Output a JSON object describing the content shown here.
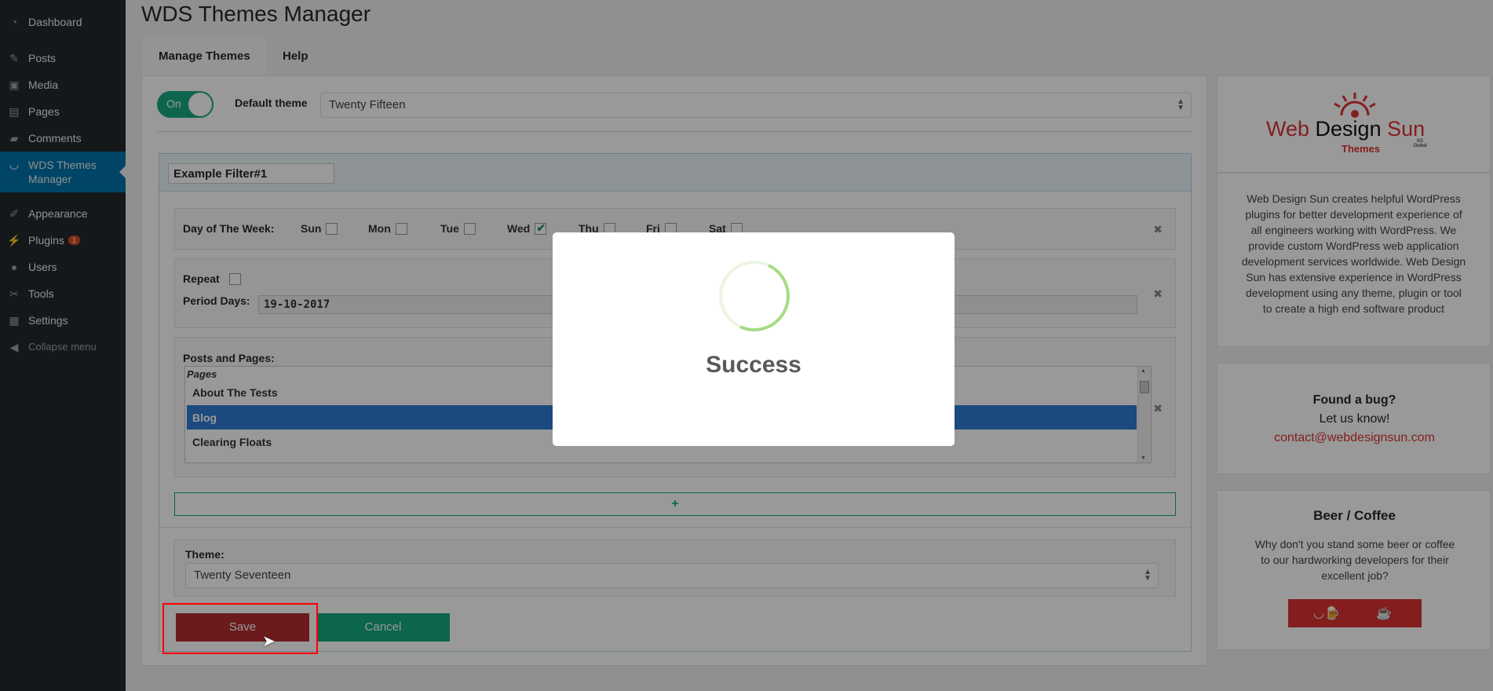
{
  "sidebar": {
    "items": [
      {
        "label": "Dashboard",
        "icon": "dashboard-icon"
      },
      {
        "label": "Posts",
        "icon": "pin-icon"
      },
      {
        "label": "Media",
        "icon": "media-icon"
      },
      {
        "label": "Pages",
        "icon": "pages-icon"
      },
      {
        "label": "Comments",
        "icon": "comment-icon"
      },
      {
        "label": "WDS Themes Manager",
        "icon": "smile-icon"
      },
      {
        "label": "Appearance",
        "icon": "brush-icon"
      },
      {
        "label": "Plugins",
        "icon": "plug-icon",
        "badge": "1"
      },
      {
        "label": "Users",
        "icon": "user-icon"
      },
      {
        "label": "Tools",
        "icon": "wrench-icon"
      },
      {
        "label": "Settings",
        "icon": "settings-icon"
      },
      {
        "label": "Collapse menu",
        "icon": "collapse-icon"
      }
    ]
  },
  "page": {
    "title": "WDS Themes Manager"
  },
  "tabs": [
    {
      "label": "Manage Themes"
    },
    {
      "label": "Help"
    }
  ],
  "toggle": {
    "label": "On",
    "state": "on"
  },
  "default_theme": {
    "label": "Default theme",
    "value": "Twenty Fifteen"
  },
  "filter": {
    "name": "Example Filter#1",
    "days_label": "Day of The Week:",
    "days": [
      {
        "label": "Sun",
        "checked": false
      },
      {
        "label": "Mon",
        "checked": false
      },
      {
        "label": "Tue",
        "checked": false
      },
      {
        "label": "Wed",
        "checked": true
      },
      {
        "label": "Thu",
        "checked": false
      },
      {
        "label": "Fri",
        "checked": false
      },
      {
        "label": "Sat",
        "checked": false
      }
    ],
    "repeat_label": "Repeat",
    "period_label": "Period Days:",
    "period_value": "19-10-2017",
    "posts_label": "Posts and Pages:",
    "group": "Pages",
    "items": [
      {
        "label": "About The Tests",
        "selected": false
      },
      {
        "label": "Blog",
        "selected": true
      },
      {
        "label": "Clearing Floats",
        "selected": false
      }
    ],
    "add_label": "+",
    "theme_label": "Theme:",
    "theme_value": "Twenty Seventeen"
  },
  "buttons": {
    "save": "Save",
    "cancel": "Cancel"
  },
  "side": {
    "logo": {
      "web": "Web",
      "design": "Design",
      "sun": "Sun",
      "themes": "Themes",
      "ig": "IIG Global"
    },
    "about": "Web Design Sun creates helpful WordPress plugins for better development experience of all engineers working with WordPress. We provide custom WordPress web application development services worldwide. Web Design Sun has extensive experience in WordPress development using any theme, plugin or tool to create a high end software product",
    "bug": {
      "title": "Found a bug?",
      "text": "Let us know!",
      "email": "contact@webdesignsun.com"
    },
    "beer": {
      "title": "Beer / Coffee",
      "text": "Why don't you stand some beer or coffee to our hardworking developers for their excellent job?"
    }
  },
  "modal": {
    "title": "Success"
  },
  "colors": {
    "accent": "#17a882",
    "save": "#b32d2e",
    "wp_blue": "#0073aa",
    "sidebar": "#23282d",
    "highlight": "#ff0000"
  }
}
